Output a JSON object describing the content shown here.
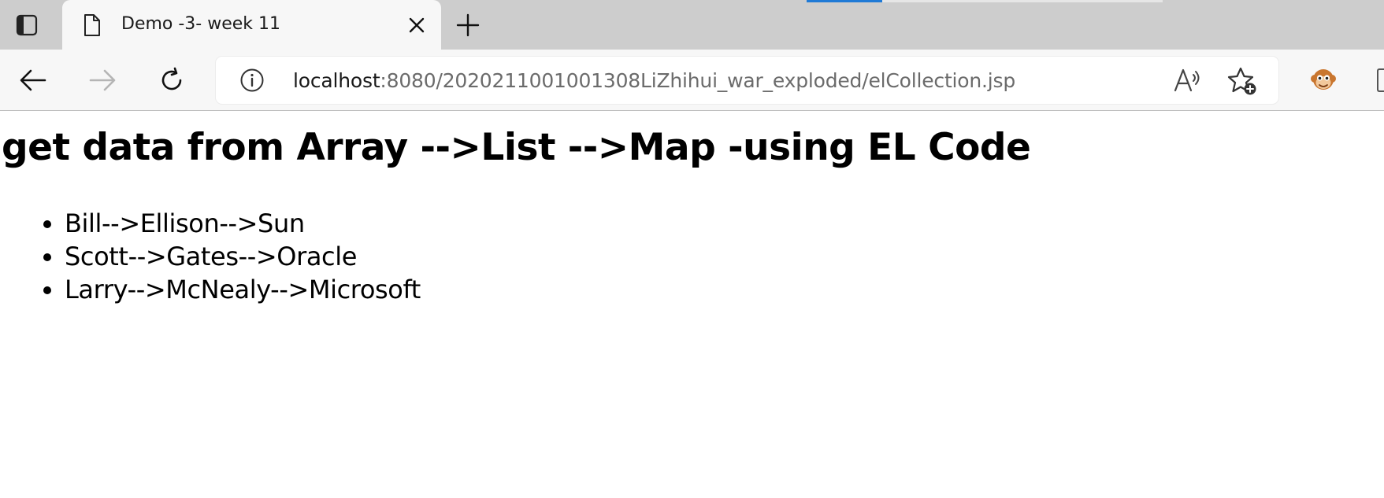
{
  "tab": {
    "title": "Demo -3- week 11"
  },
  "address_bar": {
    "host": "localhost",
    "path": ":8080/2020211001001308LiZhihui_war_exploded/elCollection.jsp"
  },
  "page": {
    "heading": "get data from Array -->List -->Map -using EL Code",
    "items": [
      "Bill-->Ellison-->Sun",
      "Scott-->Gates-->Oracle",
      "Larry-->McNealy-->Microsoft"
    ]
  },
  "icons": {
    "tab_actions": "tab-actions-icon",
    "page": "page-icon",
    "close": "close-icon",
    "new_tab": "plus-icon",
    "back": "back-arrow-icon",
    "forward": "forward-arrow-icon",
    "refresh": "refresh-icon",
    "info": "info-icon",
    "read_aloud": "read-aloud-icon",
    "favorite_add": "favorite-add-icon",
    "extension": "monkey-extension-icon"
  },
  "colors": {
    "tabstrip_bg": "#cdcdcd",
    "toolbar_bg": "#f7f7f7",
    "loading_accent": "#1f7ad6",
    "url_host": "#1a1a1a",
    "url_path": "#6b6b6b"
  }
}
